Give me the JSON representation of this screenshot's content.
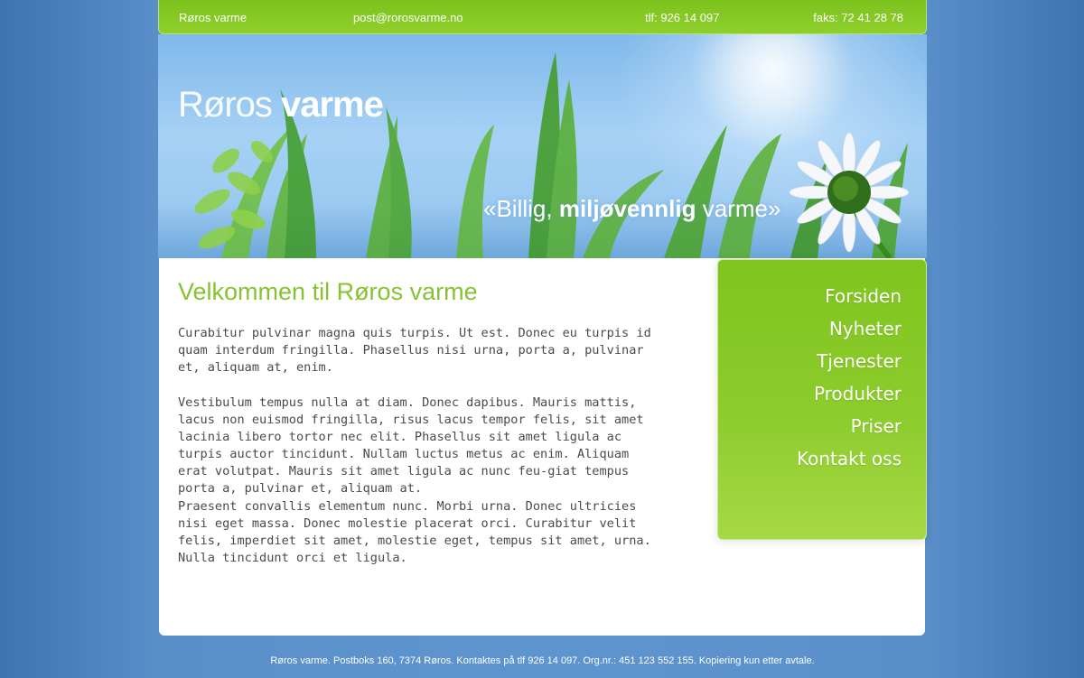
{
  "topbar": {
    "company": "Røros varme",
    "email": "post@rorosvarme.no",
    "phone": "tlf: 926 14 097",
    "fax": "faks: 72 41 28 78"
  },
  "header": {
    "logo_light": "Røros ",
    "logo_bold": "varme",
    "tagline_start": "«Billig, ",
    "tagline_bold": "miljøvennlig",
    "tagline_end": " varme»"
  },
  "content": {
    "title": "Velkommen til Røros varme",
    "paragraphs": [
      "Curabitur pulvinar magna quis turpis. Ut est. Donec eu turpis id quam interdum fringilla. Phasellus nisi urna, porta a, pulvinar et, aliquam at, enim.",
      "Vestibulum tempus nulla at diam. Donec dapibus. Mauris mattis, lacus non euismod fringilla, risus lacus tempor felis, sit amet lacinia libero tortor nec elit. Phasellus sit amet ligula ac turpis auctor tincidunt. Nullam luctus metus ac enim. Aliquam erat volutpat. Mauris sit amet ligula ac nunc feu-giat tempus porta a, pulvinar et, aliquam at.",
      "Praesent convallis elementum nunc. Morbi urna. Donec ultricies nisi eget massa. Donec molestie placerat orci. Curabitur velit felis, imperdiet sit amet, molestie eget, tempus sit amet, urna. Nulla tincidunt orci et ligula."
    ]
  },
  "menu": {
    "items": [
      {
        "label": "Forsiden"
      },
      {
        "label": "Nyheter"
      },
      {
        "label": "Tjenester"
      },
      {
        "label": "Produkter"
      },
      {
        "label": "Priser"
      },
      {
        "label": "Kontakt oss"
      }
    ]
  },
  "footer": {
    "text": "Røros varme. Postboks 160, 7374 Røros. Kontaktes på tlf 926 14 097. Org.nr.: 451 123 552 155. Kopiering kun etter avtale."
  },
  "colors": {
    "accent_green": "#86c232",
    "background_blue": "#5f95cf"
  }
}
